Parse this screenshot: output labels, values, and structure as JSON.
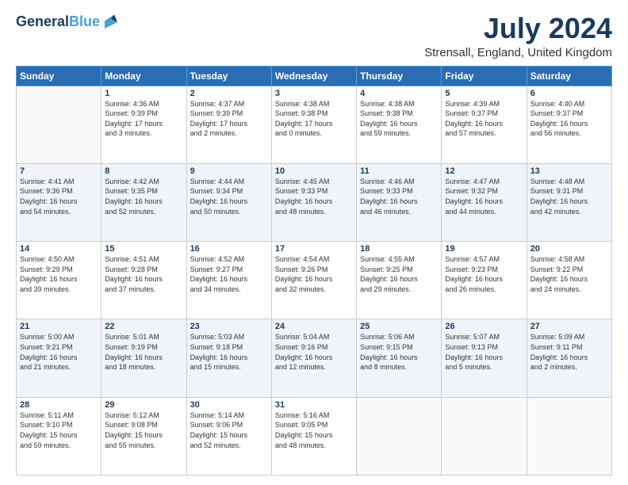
{
  "header": {
    "logo_line1": "General",
    "logo_line2": "Blue",
    "title": "July 2024",
    "subtitle": "Strensall, England, United Kingdom"
  },
  "days_of_week": [
    "Sunday",
    "Monday",
    "Tuesday",
    "Wednesday",
    "Thursday",
    "Friday",
    "Saturday"
  ],
  "weeks": [
    [
      {
        "day": "",
        "info": ""
      },
      {
        "day": "1",
        "info": "Sunrise: 4:36 AM\nSunset: 9:39 PM\nDaylight: 17 hours\nand 3 minutes."
      },
      {
        "day": "2",
        "info": "Sunrise: 4:37 AM\nSunset: 9:39 PM\nDaylight: 17 hours\nand 2 minutes."
      },
      {
        "day": "3",
        "info": "Sunrise: 4:38 AM\nSunset: 9:38 PM\nDaylight: 17 hours\nand 0 minutes."
      },
      {
        "day": "4",
        "info": "Sunrise: 4:38 AM\nSunset: 9:38 PM\nDaylight: 16 hours\nand 59 minutes."
      },
      {
        "day": "5",
        "info": "Sunrise: 4:39 AM\nSunset: 9:37 PM\nDaylight: 16 hours\nand 57 minutes."
      },
      {
        "day": "6",
        "info": "Sunrise: 4:40 AM\nSunset: 9:37 PM\nDaylight: 16 hours\nand 56 minutes."
      }
    ],
    [
      {
        "day": "7",
        "info": "Sunrise: 4:41 AM\nSunset: 9:36 PM\nDaylight: 16 hours\nand 54 minutes."
      },
      {
        "day": "8",
        "info": "Sunrise: 4:42 AM\nSunset: 9:35 PM\nDaylight: 16 hours\nand 52 minutes."
      },
      {
        "day": "9",
        "info": "Sunrise: 4:44 AM\nSunset: 9:34 PM\nDaylight: 16 hours\nand 50 minutes."
      },
      {
        "day": "10",
        "info": "Sunrise: 4:45 AM\nSunset: 9:33 PM\nDaylight: 16 hours\nand 48 minutes."
      },
      {
        "day": "11",
        "info": "Sunrise: 4:46 AM\nSunset: 9:33 PM\nDaylight: 16 hours\nand 46 minutes."
      },
      {
        "day": "12",
        "info": "Sunrise: 4:47 AM\nSunset: 9:32 PM\nDaylight: 16 hours\nand 44 minutes."
      },
      {
        "day": "13",
        "info": "Sunrise: 4:48 AM\nSunset: 9:31 PM\nDaylight: 16 hours\nand 42 minutes."
      }
    ],
    [
      {
        "day": "14",
        "info": "Sunrise: 4:50 AM\nSunset: 9:29 PM\nDaylight: 16 hours\nand 39 minutes."
      },
      {
        "day": "15",
        "info": "Sunrise: 4:51 AM\nSunset: 9:28 PM\nDaylight: 16 hours\nand 37 minutes."
      },
      {
        "day": "16",
        "info": "Sunrise: 4:52 AM\nSunset: 9:27 PM\nDaylight: 16 hours\nand 34 minutes."
      },
      {
        "day": "17",
        "info": "Sunrise: 4:54 AM\nSunset: 9:26 PM\nDaylight: 16 hours\nand 32 minutes."
      },
      {
        "day": "18",
        "info": "Sunrise: 4:55 AM\nSunset: 9:25 PM\nDaylight: 16 hours\nand 29 minutes."
      },
      {
        "day": "19",
        "info": "Sunrise: 4:57 AM\nSunset: 9:23 PM\nDaylight: 16 hours\nand 26 minutes."
      },
      {
        "day": "20",
        "info": "Sunrise: 4:58 AM\nSunset: 9:22 PM\nDaylight: 16 hours\nand 24 minutes."
      }
    ],
    [
      {
        "day": "21",
        "info": "Sunrise: 5:00 AM\nSunset: 9:21 PM\nDaylight: 16 hours\nand 21 minutes."
      },
      {
        "day": "22",
        "info": "Sunrise: 5:01 AM\nSunset: 9:19 PM\nDaylight: 16 hours\nand 18 minutes."
      },
      {
        "day": "23",
        "info": "Sunrise: 5:03 AM\nSunset: 9:18 PM\nDaylight: 16 hours\nand 15 minutes."
      },
      {
        "day": "24",
        "info": "Sunrise: 5:04 AM\nSunset: 9:16 PM\nDaylight: 16 hours\nand 12 minutes."
      },
      {
        "day": "25",
        "info": "Sunrise: 5:06 AM\nSunset: 9:15 PM\nDaylight: 16 hours\nand 8 minutes."
      },
      {
        "day": "26",
        "info": "Sunrise: 5:07 AM\nSunset: 9:13 PM\nDaylight: 16 hours\nand 5 minutes."
      },
      {
        "day": "27",
        "info": "Sunrise: 5:09 AM\nSunset: 9:11 PM\nDaylight: 16 hours\nand 2 minutes."
      }
    ],
    [
      {
        "day": "28",
        "info": "Sunrise: 5:11 AM\nSunset: 9:10 PM\nDaylight: 15 hours\nand 59 minutes."
      },
      {
        "day": "29",
        "info": "Sunrise: 5:12 AM\nSunset: 9:08 PM\nDaylight: 15 hours\nand 55 minutes."
      },
      {
        "day": "30",
        "info": "Sunrise: 5:14 AM\nSunset: 9:06 PM\nDaylight: 15 hours\nand 52 minutes."
      },
      {
        "day": "31",
        "info": "Sunrise: 5:16 AM\nSunset: 9:05 PM\nDaylight: 15 hours\nand 48 minutes."
      },
      {
        "day": "",
        "info": ""
      },
      {
        "day": "",
        "info": ""
      },
      {
        "day": "",
        "info": ""
      }
    ]
  ]
}
